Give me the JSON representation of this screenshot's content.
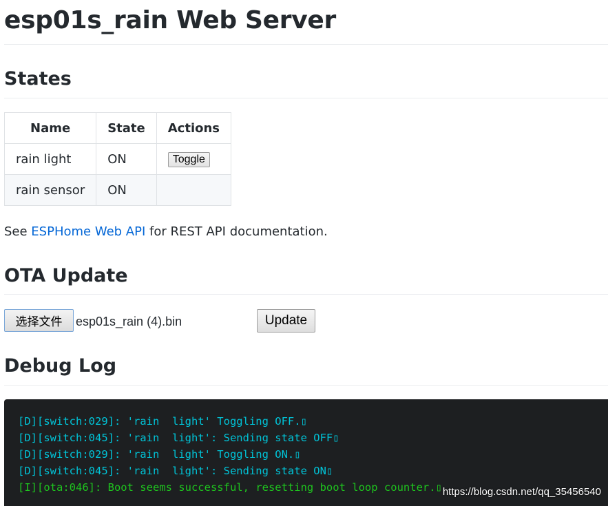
{
  "page_title": "esp01s_rain Web Server",
  "states": {
    "heading": "States",
    "columns": [
      "Name",
      "State",
      "Actions"
    ],
    "rows": [
      {
        "name": "rain light",
        "state": "ON",
        "action": "Toggle"
      },
      {
        "name": "rain sensor",
        "state": "ON",
        "action": ""
      }
    ]
  },
  "api_note": {
    "prefix": "See ",
    "link_text": "ESPHome Web API",
    "suffix": " for REST API documentation."
  },
  "ota": {
    "heading": "OTA Update",
    "choose_file_label": "选择文件",
    "file_name": "esp01s_rain (4).bin",
    "update_label": "Update"
  },
  "debug_log": {
    "heading": "Debug Log",
    "lines": [
      {
        "level": "debug",
        "text": "[D][switch:029]: 'rain  light' Toggling OFF.▯"
      },
      {
        "level": "debug",
        "text": "[D][switch:045]: 'rain  light': Sending state OFF▯"
      },
      {
        "level": "debug",
        "text": "[D][switch:029]: 'rain  light' Toggling ON.▯"
      },
      {
        "level": "debug",
        "text": "[D][switch:045]: 'rain  light': Sending state ON▯"
      },
      {
        "level": "info",
        "text": "[I][ota:046]: Boot seems successful, resetting boot loop counter.▯"
      }
    ]
  },
  "watermark": "https://blog.csdn.net/qq_35456540",
  "colors": {
    "link": "#0366d6",
    "log_background": "#1d1f21",
    "log_debug": "#00c4d8",
    "log_info": "#1ec41e",
    "table_alt_row": "#f6f8fa"
  }
}
